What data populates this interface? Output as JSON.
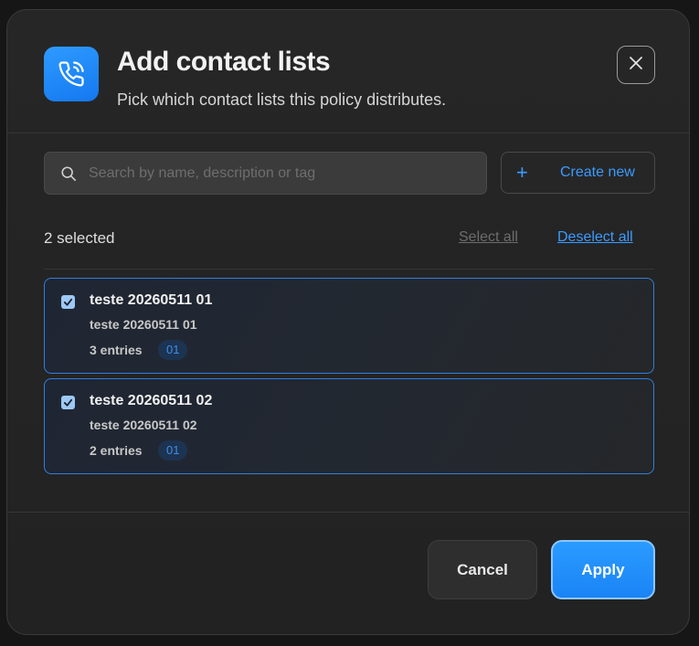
{
  "dialog": {
    "title": "Add contact lists",
    "subtitle": "Pick which contact lists this policy distributes.",
    "header_icon": "phone-call-icon",
    "close_icon": "close-icon"
  },
  "search": {
    "placeholder": "Search by name, description or tag",
    "value": "",
    "icon": "search-icon"
  },
  "create_button": {
    "icon": "plus-icon",
    "label": "Create new"
  },
  "selection": {
    "count_label": "2 selected",
    "select_all_label": "Select all",
    "deselect_all_label": "Deselect all"
  },
  "lists": [
    {
      "name": "teste 20260511 01",
      "description": "teste 20260511 01",
      "entries": "3 entries",
      "tag": "01",
      "checked": true
    },
    {
      "name": "teste 20260511 02",
      "description": "teste 20260511 02",
      "entries": "2 entries",
      "tag": "01",
      "checked": true
    }
  ],
  "footer": {
    "cancel_label": "Cancel",
    "apply_label": "Apply"
  },
  "colors": {
    "accent": "#1a84f5",
    "link": "#3b9bff",
    "background": "#242424"
  }
}
